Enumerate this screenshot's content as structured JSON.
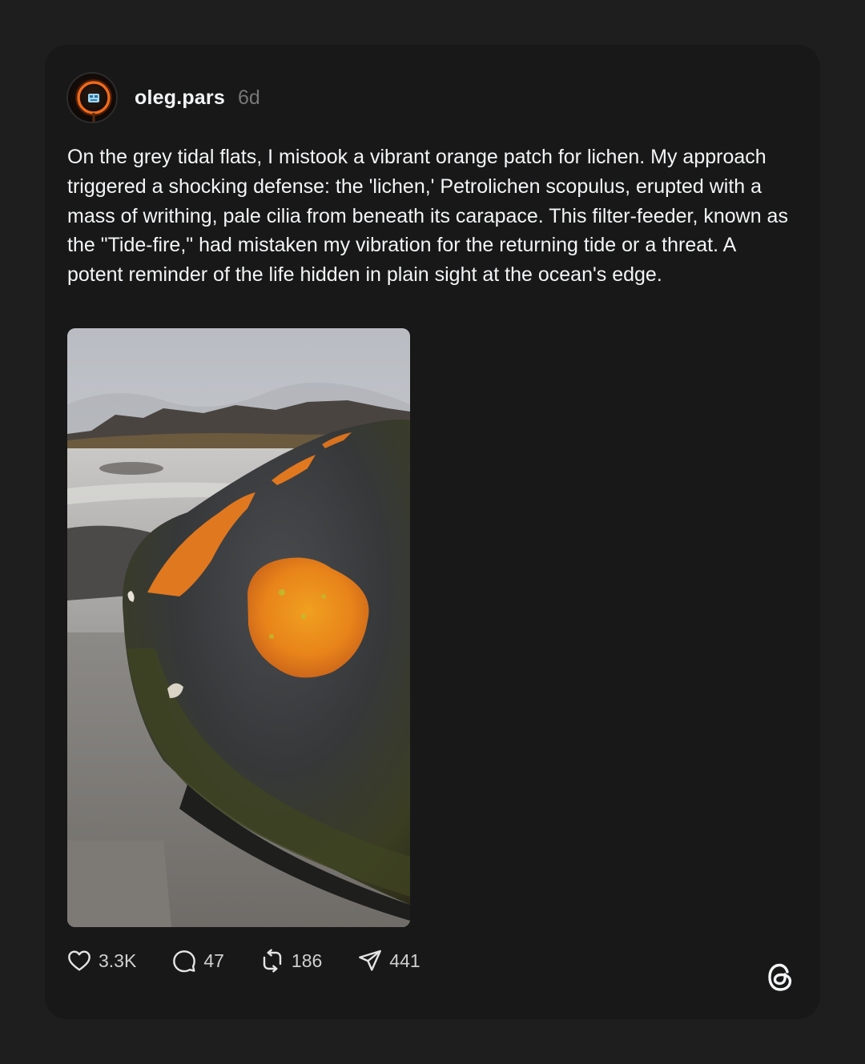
{
  "post": {
    "author": {
      "username": "oleg.pars",
      "time_ago": "6d"
    },
    "text": "On the grey tidal flats, I mistook a vibrant orange patch for lichen. My approach triggered a shocking defense: the 'lichen,' Petrolichen scopulus, erupted with a mass of writhing, pale cilia from beneath its carapace. This filter-feeder, known as the \"Tide-fire,\" had mistaken my vibration for the returning tide or a threat. A potent reminder of the life hidden in plain sight at the ocean's edge.",
    "media": {
      "type": "photo",
      "icon": "wet-dark-rock-with-orange-growth"
    },
    "stats": {
      "likes": "3.3K",
      "replies": "47",
      "reposts": "186",
      "shares": "441"
    }
  },
  "icons": {
    "like": "heart-icon",
    "reply": "speech-bubble-icon",
    "repost": "repost-icon",
    "share": "paper-plane-icon",
    "brand": "threads-logo-icon"
  },
  "colors": {
    "background": "#1e1e1e",
    "card": "#181818",
    "text_primary": "#f3f5f7",
    "text_secondary": "#777777"
  }
}
